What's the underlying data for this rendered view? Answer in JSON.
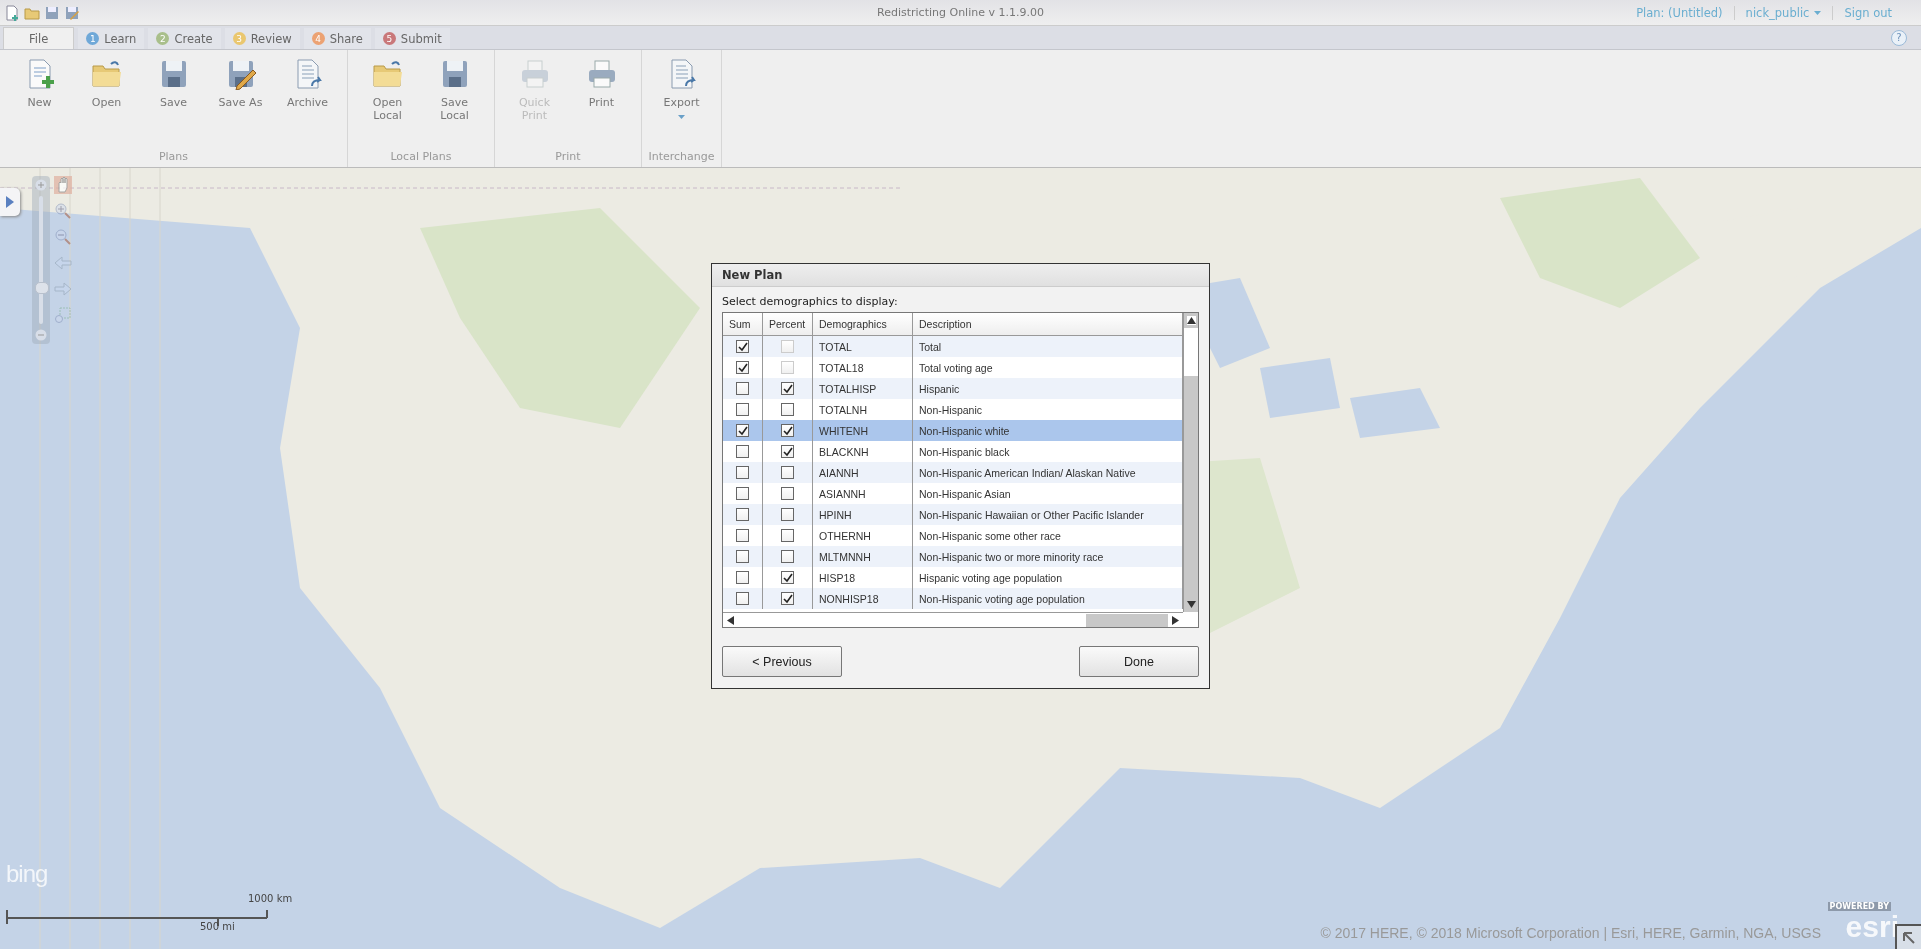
{
  "app": {
    "title": "Redistricting Online  v 1.1.9.00",
    "plan": "Plan: (Untitled)",
    "user": "nick_public",
    "sign_out": "Sign out"
  },
  "tabs": [
    {
      "label": "File",
      "selected": true
    },
    {
      "number": "1",
      "label": "Learn",
      "color": "#6fa8d8",
      "selected": false
    },
    {
      "number": "2",
      "label": "Create",
      "color": "#a9bf8b",
      "selected": false
    },
    {
      "number": "3",
      "label": "Review",
      "color": "#eac76f",
      "selected": false
    },
    {
      "number": "4",
      "label": "Share",
      "color": "#eca273",
      "selected": false
    },
    {
      "number": "5",
      "label": "Submit",
      "color": "#c9787a",
      "selected": false
    }
  ],
  "help": "?",
  "ribbon": [
    {
      "label": "Plans",
      "buttons": [
        {
          "kind": "new",
          "label": "New",
          "disabled": false
        },
        {
          "kind": "open",
          "label": "Open",
          "disabled": false
        },
        {
          "kind": "save",
          "label": "Save",
          "disabled": false
        },
        {
          "kind": "saveas",
          "label": "Save As",
          "disabled": false
        },
        {
          "kind": "archive",
          "label": "Archive",
          "disabled": false
        }
      ]
    },
    {
      "label": "Local Plans",
      "buttons": [
        {
          "kind": "open",
          "label": "Open\nLocal",
          "disabled": false
        },
        {
          "kind": "save",
          "label": "Save\nLocal",
          "disabled": false
        }
      ]
    },
    {
      "label": "Print",
      "buttons": [
        {
          "kind": "print",
          "label": "Quick\nPrint",
          "disabled": true
        },
        {
          "kind": "print",
          "label": "Print",
          "disabled": false
        }
      ]
    },
    {
      "label": "Interchange",
      "buttons": [
        {
          "kind": "export",
          "label": "Export",
          "disabled": false,
          "dropdown": true
        }
      ]
    }
  ],
  "map": {
    "zoom": {
      "level": 0.27
    },
    "logo": "bing",
    "scale": {
      "km": "1000 km",
      "mi": "500 mi"
    },
    "attribution": "© 2017 HERE, © 2018 Microsoft Corporation | Esri, HERE, Garmin, NGA, USGS",
    "powered_by": "POWERED BY",
    "esri": "esri"
  },
  "dialog": {
    "title": "New Plan",
    "prompt": "Select demographics to display:",
    "columns": [
      "Sum",
      "Percent",
      "Demographics",
      "Description"
    ],
    "rows": [
      {
        "sum": true,
        "percent": false,
        "percent_disabled": true,
        "code": "TOTAL",
        "description": "Total",
        "selected": false
      },
      {
        "sum": true,
        "percent": false,
        "percent_disabled": true,
        "code": "TOTAL18",
        "description": "Total voting age",
        "selected": false
      },
      {
        "sum": false,
        "percent": true,
        "percent_disabled": false,
        "code": "TOTALHISP",
        "description": "Hispanic",
        "selected": false
      },
      {
        "sum": false,
        "percent": false,
        "percent_disabled": false,
        "code": "TOTALNH",
        "description": "Non-Hispanic",
        "selected": false
      },
      {
        "sum": true,
        "percent": true,
        "percent_disabled": false,
        "code": "WHITENH",
        "description": "Non-Hispanic white",
        "selected": true
      },
      {
        "sum": false,
        "percent": true,
        "percent_disabled": false,
        "code": "BLACKNH",
        "description": "Non-Hispanic black",
        "selected": false
      },
      {
        "sum": false,
        "percent": false,
        "percent_disabled": false,
        "code": "AIANNH",
        "description": "Non-Hispanic American Indian/ Alaskan Native",
        "selected": false
      },
      {
        "sum": false,
        "percent": false,
        "percent_disabled": false,
        "code": "ASIANNH",
        "description": "Non-Hispanic Asian",
        "selected": false
      },
      {
        "sum": false,
        "percent": false,
        "percent_disabled": false,
        "code": "HPINH",
        "description": "Non-Hispanic Hawaiian or Other Pacific Islander",
        "selected": false
      },
      {
        "sum": false,
        "percent": false,
        "percent_disabled": false,
        "code": "OTHERNH",
        "description": "Non-Hispanic some other race",
        "selected": false
      },
      {
        "sum": false,
        "percent": false,
        "percent_disabled": false,
        "code": "MLTMNNH",
        "description": "Non-Hispanic two or more minority race",
        "selected": false
      },
      {
        "sum": false,
        "percent": true,
        "percent_disabled": false,
        "code": "HISP18",
        "description": "Hispanic voting age population",
        "selected": false
      },
      {
        "sum": false,
        "percent": true,
        "percent_disabled": false,
        "code": "NONHISP18",
        "description": "Non-Hispanic voting age population",
        "selected": false
      }
    ],
    "buttons": [
      "< Previous",
      "Done"
    ]
  }
}
